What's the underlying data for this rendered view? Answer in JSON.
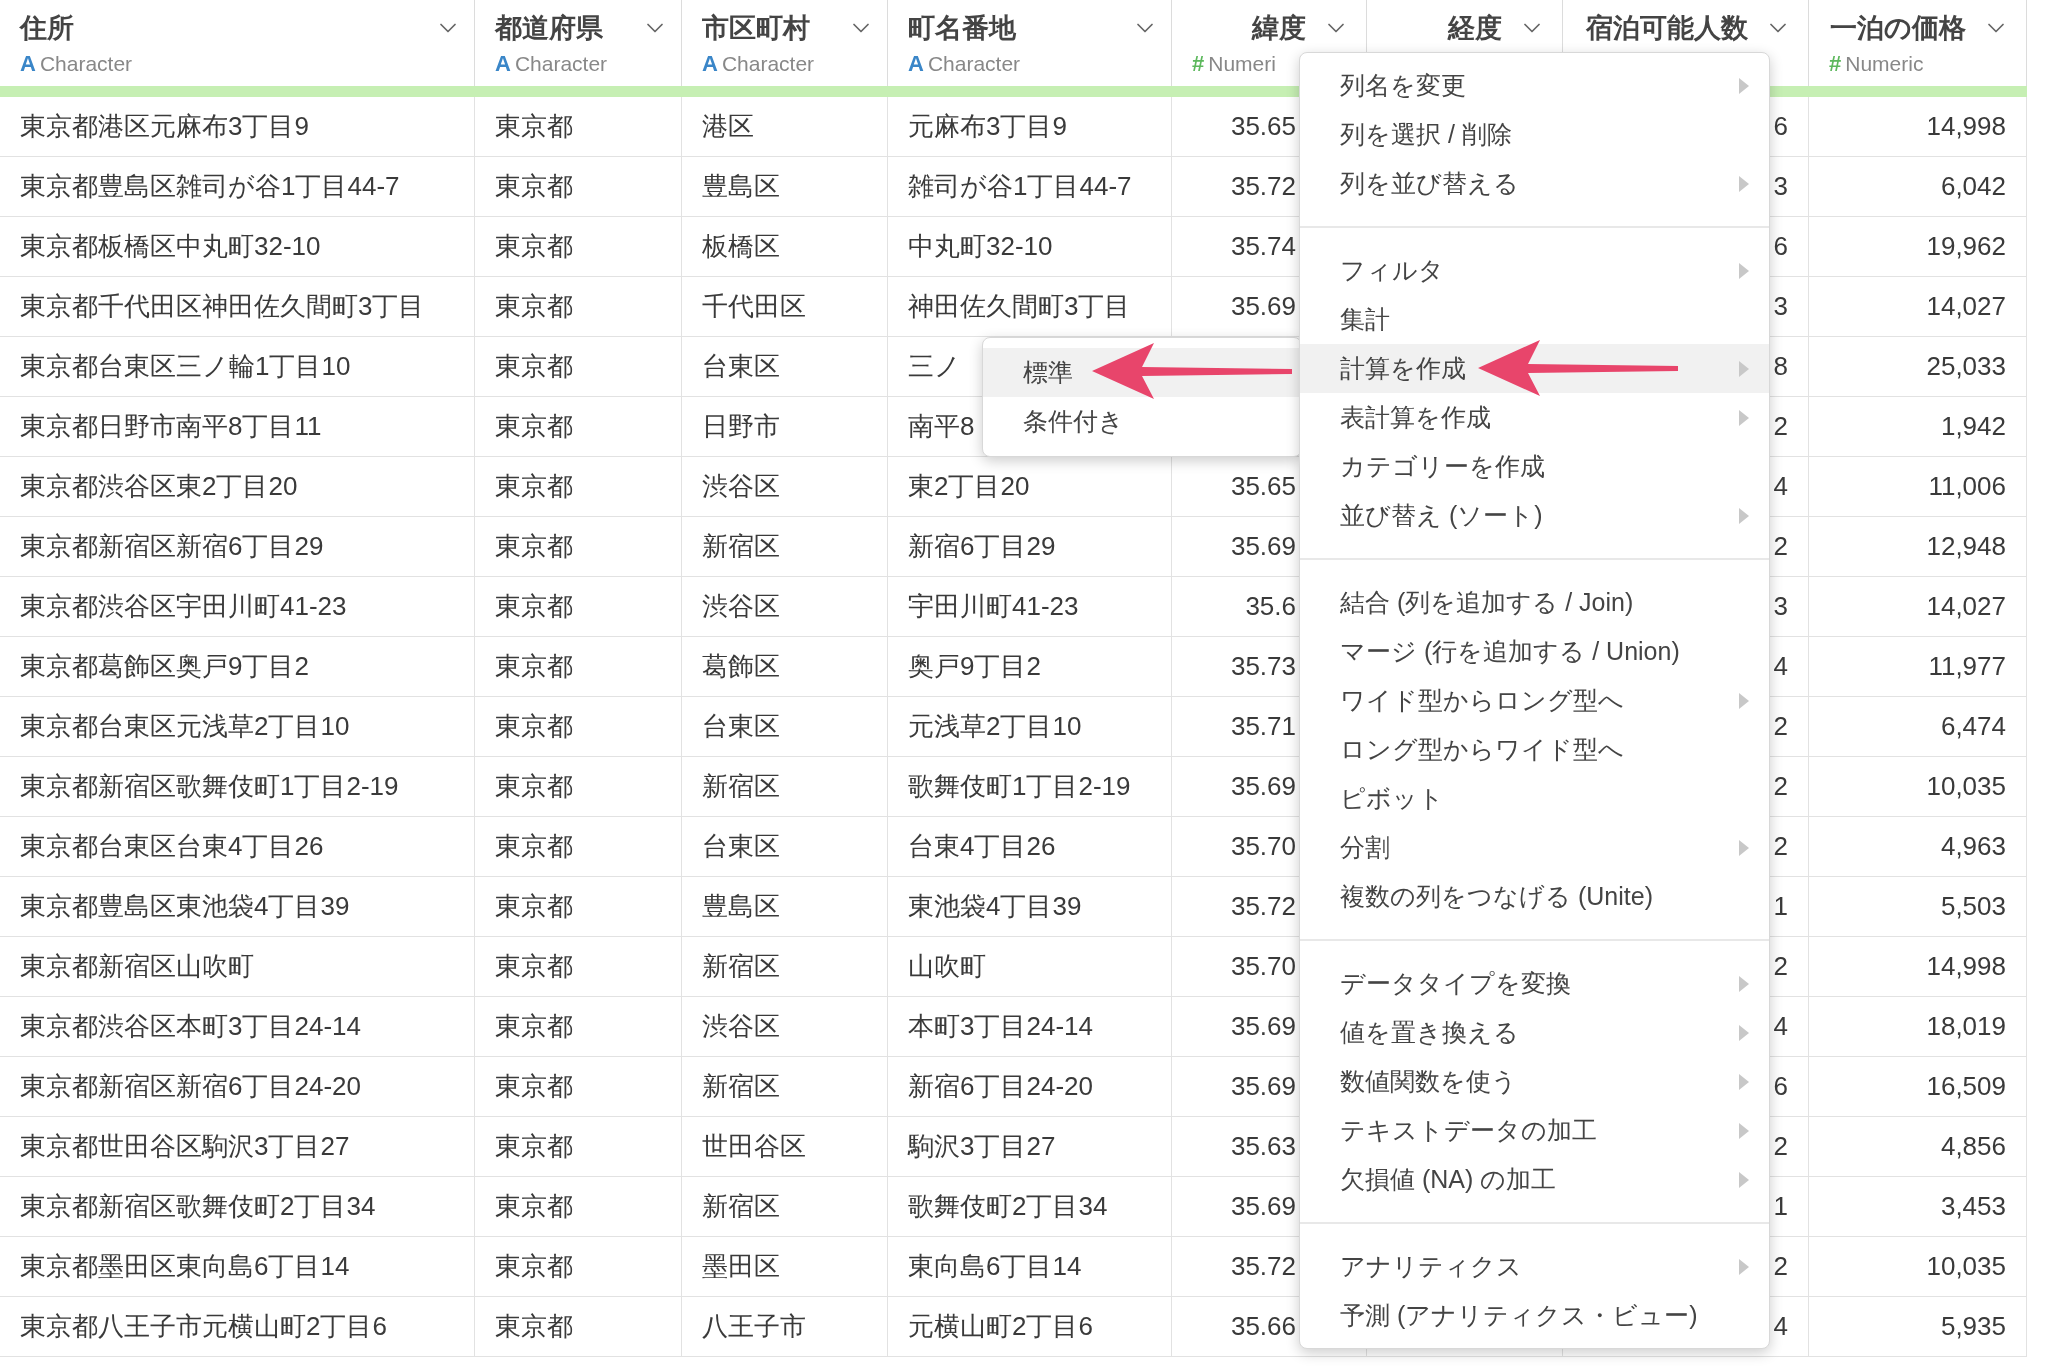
{
  "columns": [
    {
      "title": "住所",
      "kind": "character",
      "symbol": "A",
      "type": "Character"
    },
    {
      "title": "都道府県",
      "kind": "character",
      "symbol": "A",
      "type": "Character"
    },
    {
      "title": "市区町村",
      "kind": "character",
      "symbol": "A",
      "type": "Character"
    },
    {
      "title": "町名番地",
      "kind": "character",
      "symbol": "A",
      "type": "Character"
    },
    {
      "title": "緯度",
      "kind": "numeric",
      "symbol": "#",
      "type": "Numeri"
    },
    {
      "title": "経度",
      "kind": "numeric"
    },
    {
      "title": "宿泊可能人数",
      "kind": "numeric"
    },
    {
      "title": "一泊の価格",
      "kind": "numeric",
      "symbol": "#",
      "type": "Numeric"
    }
  ],
  "rows": [
    {
      "address": "東京都港区元麻布3丁目9",
      "prefecture": "東京都",
      "city": "港区",
      "town": "元麻布3丁目9",
      "latitude": "35.65",
      "capacity": "6",
      "price": "14,998"
    },
    {
      "address": "東京都豊島区雑司が谷1丁目44-7",
      "prefecture": "東京都",
      "city": "豊島区",
      "town": "雑司が谷1丁目44-7",
      "latitude": "35.72",
      "capacity": "3",
      "price": "6,042"
    },
    {
      "address": "東京都板橋区中丸町32-10",
      "prefecture": "東京都",
      "city": "板橋区",
      "town": "中丸町32-10",
      "latitude": "35.74",
      "capacity": "6",
      "price": "19,962"
    },
    {
      "address": "東京都千代田区神田佐久間町3丁目",
      "prefecture": "東京都",
      "city": "千代田区",
      "town": "神田佐久間町3丁目",
      "latitude": "35.69",
      "capacity": "3",
      "price": "14,027"
    },
    {
      "address": "東京都台東区三ノ輪1丁目10",
      "prefecture": "東京都",
      "city": "台東区",
      "town": "三ノ",
      "capacity": "8",
      "price": "25,033"
    },
    {
      "address": "東京都日野市南平8丁目11",
      "prefecture": "東京都",
      "city": "日野市",
      "town": "南平8",
      "capacity": "2",
      "price": "1,942"
    },
    {
      "address": "東京都渋谷区東2丁目20",
      "prefecture": "東京都",
      "city": "渋谷区",
      "town": "東2丁目20",
      "latitude": "35.65",
      "capacity": "4",
      "price": "11,006"
    },
    {
      "address": "東京都新宿区新宿6丁目29",
      "prefecture": "東京都",
      "city": "新宿区",
      "town": "新宿6丁目29",
      "latitude": "35.69",
      "capacity": "2",
      "price": "12,948"
    },
    {
      "address": "東京都渋谷区宇田川町41-23",
      "prefecture": "東京都",
      "city": "渋谷区",
      "town": "宇田川町41-23",
      "latitude": "35.6",
      "capacity": "3",
      "price": "14,027"
    },
    {
      "address": "東京都葛飾区奥戸9丁目2",
      "prefecture": "東京都",
      "city": "葛飾区",
      "town": "奥戸9丁目2",
      "latitude": "35.73",
      "capacity": "4",
      "price": "11,977"
    },
    {
      "address": "東京都台東区元浅草2丁目10",
      "prefecture": "東京都",
      "city": "台東区",
      "town": "元浅草2丁目10",
      "latitude": "35.71",
      "capacity": "2",
      "price": "6,474"
    },
    {
      "address": "東京都新宿区歌舞伎町1丁目2-19",
      "prefecture": "東京都",
      "city": "新宿区",
      "town": "歌舞伎町1丁目2-19",
      "latitude": "35.69",
      "capacity": "2",
      "price": "10,035"
    },
    {
      "address": "東京都台東区台東4丁目26",
      "prefecture": "東京都",
      "city": "台東区",
      "town": "台東4丁目26",
      "latitude": "35.70",
      "capacity": "2",
      "price": "4,963"
    },
    {
      "address": "東京都豊島区東池袋4丁目39",
      "prefecture": "東京都",
      "city": "豊島区",
      "town": "東池袋4丁目39",
      "latitude": "35.72",
      "capacity": "1",
      "price": "5,503"
    },
    {
      "address": "東京都新宿区山吹町",
      "prefecture": "東京都",
      "city": "新宿区",
      "town": "山吹町",
      "latitude": "35.70",
      "capacity": "2",
      "price": "14,998"
    },
    {
      "address": "東京都渋谷区本町3丁目24-14",
      "prefecture": "東京都",
      "city": "渋谷区",
      "town": "本町3丁目24-14",
      "latitude": "35.69",
      "capacity": "4",
      "price": "18,019"
    },
    {
      "address": "東京都新宿区新宿6丁目24-20",
      "prefecture": "東京都",
      "city": "新宿区",
      "town": "新宿6丁目24-20",
      "latitude": "35.69",
      "capacity": "6",
      "price": "16,509"
    },
    {
      "address": "東京都世田谷区駒沢3丁目27",
      "prefecture": "東京都",
      "city": "世田谷区",
      "town": "駒沢3丁目27",
      "latitude": "35.63",
      "capacity": "2",
      "price": "4,856"
    },
    {
      "address": "東京都新宿区歌舞伎町2丁目34",
      "prefecture": "東京都",
      "city": "新宿区",
      "town": "歌舞伎町2丁目34",
      "latitude": "35.69",
      "capacity": "1",
      "price": "3,453"
    },
    {
      "address": "東京都墨田区東向島6丁目14",
      "prefecture": "東京都",
      "city": "墨田区",
      "town": "東向島6丁目14",
      "latitude": "35.72",
      "capacity": "2",
      "price": "10,035"
    },
    {
      "address": "東京都八王子市元横山町2丁目6",
      "prefecture": "東京都",
      "city": "八王子市",
      "town": "元横山町2丁目6",
      "latitude": "35.66",
      "capacity": "4",
      "price": "5,935"
    }
  ],
  "context_menu": {
    "sections": [
      [
        {
          "label": "列名を変更",
          "submenu": true,
          "selected": false
        },
        {
          "label": "列を選択 / 削除",
          "submenu": false,
          "selected": false
        },
        {
          "label": "列を並び替える",
          "submenu": true,
          "selected": false
        }
      ],
      [
        {
          "label": "フィルタ",
          "submenu": true,
          "selected": false
        },
        {
          "label": "集計",
          "submenu": false,
          "selected": false
        },
        {
          "label": "計算を作成",
          "submenu": true,
          "selected": true
        },
        {
          "label": "表計算を作成",
          "submenu": true,
          "selected": false
        },
        {
          "label": "カテゴリーを作成",
          "submenu": false,
          "selected": false
        },
        {
          "label": "並び替え (ソート)",
          "submenu": true,
          "selected": false
        }
      ],
      [
        {
          "label": "結合 (列を追加する / Join)",
          "submenu": false,
          "selected": false
        },
        {
          "label": "マージ (行を追加する / Union)",
          "submenu": false,
          "selected": false
        },
        {
          "label": "ワイド型からロング型へ",
          "submenu": true,
          "selected": false
        },
        {
          "label": "ロング型からワイド型へ",
          "submenu": false,
          "selected": false
        },
        {
          "label": "ピボット",
          "submenu": false,
          "selected": false
        },
        {
          "label": "分割",
          "submenu": true,
          "selected": false
        },
        {
          "label": "複数の列をつなげる (Unite)",
          "submenu": false,
          "selected": false
        }
      ],
      [
        {
          "label": "データタイプを変換",
          "submenu": true,
          "selected": false
        },
        {
          "label": "値を置き換える",
          "submenu": true,
          "selected": false
        },
        {
          "label": "数値関数を使う",
          "submenu": true,
          "selected": false
        },
        {
          "label": "テキストデータの加工",
          "submenu": true,
          "selected": false
        },
        {
          "label": "欠損値 (NA) の加工",
          "submenu": true,
          "selected": false
        }
      ],
      [
        {
          "label": "アナリティクス",
          "submenu": true,
          "selected": false
        },
        {
          "label": "予測 (アナリティクス・ビュー)",
          "submenu": false,
          "selected": false
        }
      ]
    ]
  },
  "submenu": {
    "items": [
      {
        "label": "標準",
        "selected": true
      },
      {
        "label": "条件付き",
        "selected": false
      }
    ]
  }
}
